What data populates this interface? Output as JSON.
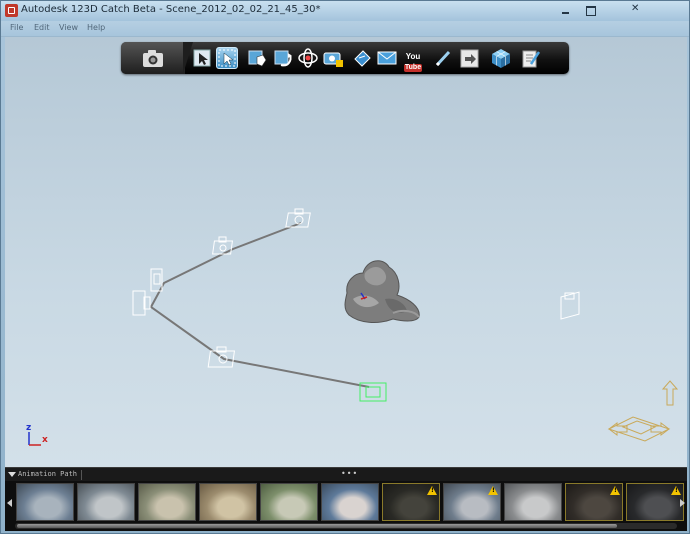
{
  "window": {
    "title": "Autodesk 123D Catch Beta - Scene_2012_02_02_21_45_30*"
  },
  "menu": {
    "items": [
      "File",
      "Edit",
      "View",
      "Help"
    ]
  },
  "toolbar": {
    "camera_tab_icon": "camera-icon",
    "tools": [
      {
        "name": "select-arrow-icon",
        "active": false
      },
      {
        "name": "select-region-icon",
        "active": true
      },
      {
        "name": "pan-icon",
        "active": false
      },
      {
        "name": "rotate-icon",
        "active": false
      },
      {
        "name": "orbit-icon",
        "active": false
      },
      {
        "name": "camera-view-icon",
        "active": false
      },
      {
        "name": "share-icon",
        "active": false
      },
      {
        "name": "email-icon",
        "active": false
      },
      {
        "name": "youtube-icon",
        "active": false
      },
      {
        "name": "edit-pen-icon",
        "active": false
      },
      {
        "name": "export-icon",
        "active": false
      },
      {
        "name": "mesh-cube-icon",
        "active": false
      },
      {
        "name": "document-edit-icon",
        "active": false
      }
    ],
    "youtube_you": "You",
    "youtube_tube": "Tube"
  },
  "viewport": {
    "axis_z": "z",
    "axis_x": "x",
    "model": "3d-scanned-statue",
    "navigation_widget": "view-cube-arrows-icon"
  },
  "timeline": {
    "title": "Animation Path",
    "grip": "•••",
    "thumbnails": [
      {
        "warning": false,
        "dim": false
      },
      {
        "warning": false,
        "dim": false
      },
      {
        "warning": false,
        "dim": false
      },
      {
        "warning": false,
        "dim": false
      },
      {
        "warning": false,
        "dim": false
      },
      {
        "warning": false,
        "dim": false
      },
      {
        "warning": true,
        "dim": true
      },
      {
        "warning": true,
        "dim": false
      },
      {
        "warning": false,
        "dim": false
      },
      {
        "warning": true,
        "dim": true
      },
      {
        "warning": true,
        "dim": true
      }
    ]
  },
  "colors": {
    "toolbar_bg": "#111111",
    "active_tool": "#3c8ec4",
    "camera_wire": "#ffffff",
    "selected_camera_wire": "#44ee66",
    "path_line": "#777777",
    "warning": "#f2c300",
    "timeline_bg": "#0e0e0e"
  }
}
